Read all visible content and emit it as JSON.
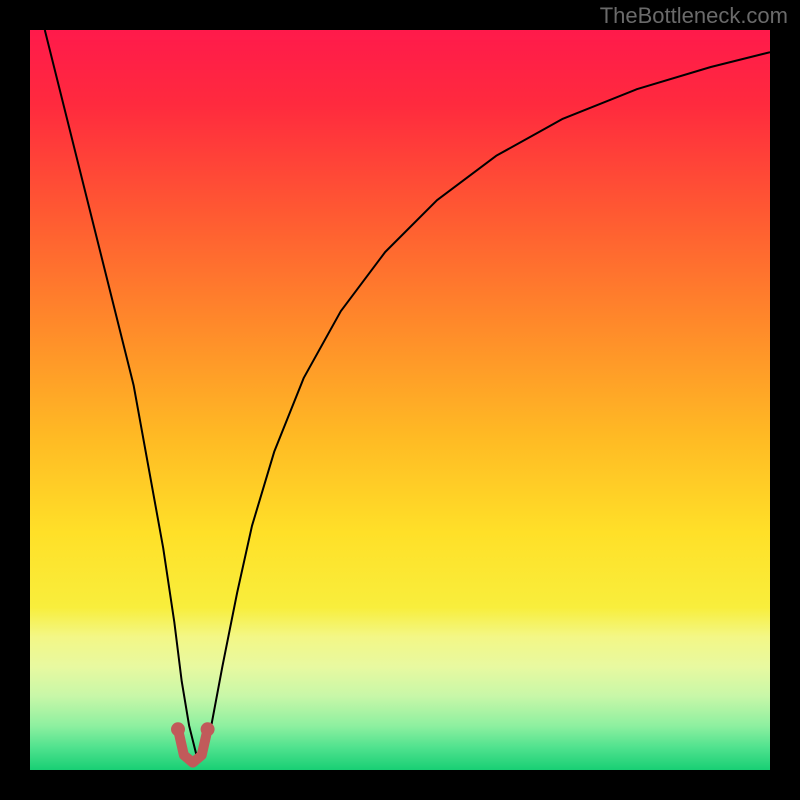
{
  "watermark": "TheBottleneck.com",
  "chart_data": {
    "type": "line",
    "title": "",
    "xlabel": "",
    "ylabel": "",
    "xlim": [
      0,
      100
    ],
    "ylim": [
      0,
      100
    ],
    "background_gradient": {
      "stops": [
        {
          "pos": 0.0,
          "color": "#ff1a4b"
        },
        {
          "pos": 0.1,
          "color": "#ff2a3e"
        },
        {
          "pos": 0.25,
          "color": "#ff5a32"
        },
        {
          "pos": 0.4,
          "color": "#ff8a2a"
        },
        {
          "pos": 0.55,
          "color": "#ffba24"
        },
        {
          "pos": 0.68,
          "color": "#ffe028"
        },
        {
          "pos": 0.78,
          "color": "#f8ee3c"
        },
        {
          "pos": 0.82,
          "color": "#f3f786"
        },
        {
          "pos": 0.86,
          "color": "#e8f9a0"
        },
        {
          "pos": 0.9,
          "color": "#c8f7a8"
        },
        {
          "pos": 0.94,
          "color": "#8ef0a0"
        },
        {
          "pos": 0.97,
          "color": "#4fe28e"
        },
        {
          "pos": 1.0,
          "color": "#18cf74"
        }
      ]
    },
    "series": [
      {
        "name": "bottleneck-curve",
        "stroke": "#000000",
        "stroke_width": 2,
        "x": [
          2,
          5,
          8,
          11,
          14,
          16,
          18,
          19.5,
          20.5,
          21.5,
          22.5,
          23.5,
          24.5,
          26,
          28,
          30,
          33,
          37,
          42,
          48,
          55,
          63,
          72,
          82,
          92,
          100
        ],
        "values": [
          100,
          88,
          76,
          64,
          52,
          41,
          30,
          20,
          12,
          6,
          2,
          2,
          6,
          14,
          24,
          33,
          43,
          53,
          62,
          70,
          77,
          83,
          88,
          92,
          95,
          97
        ]
      },
      {
        "name": "optimum-marker",
        "type": "marker",
        "stroke": "#c15a5a",
        "stroke_width": 10,
        "linecap": "round",
        "dot_r": 7,
        "x": [
          20.0,
          20.8,
          22.0,
          23.2,
          24.0
        ],
        "values": [
          5.5,
          2.0,
          1.0,
          2.0,
          5.5
        ]
      }
    ]
  }
}
